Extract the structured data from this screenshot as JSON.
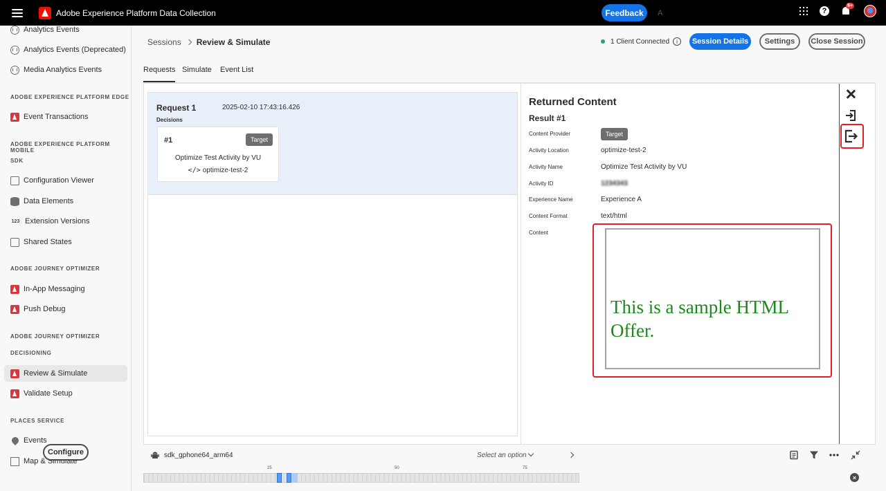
{
  "topbar": {
    "app_title": "Adobe Experience Platform Data Collection",
    "feedback_label": "Feedback",
    "org_picker": "A",
    "notification_count": "9+"
  },
  "sidebar": {
    "items": [
      {
        "label": "Analytics Events",
        "icon": "analytics-icon"
      },
      {
        "label": "Analytics Events (Deprecated)",
        "icon": "analytics-icon"
      },
      {
        "label": "Media Analytics Events",
        "icon": "analytics-icon"
      },
      {
        "label": "Event Transactions",
        "icon": "adobe-icon"
      },
      {
        "label": "Configuration Viewer",
        "icon": "viewer-icon"
      },
      {
        "label": "Data Elements",
        "icon": "database-icon"
      },
      {
        "label": "Extension Versions",
        "icon": "number-icon",
        "icon_text": "123"
      },
      {
        "label": "Shared States",
        "icon": "stack-icon"
      },
      {
        "label": "In-App Messaging",
        "icon": "adobe-icon"
      },
      {
        "label": "Push Debug",
        "icon": "adobe-icon"
      },
      {
        "label": "Review & Simulate",
        "icon": "adobe-icon",
        "active": true
      },
      {
        "label": "Validate Setup",
        "icon": "adobe-icon"
      },
      {
        "label": "Events",
        "icon": "pin-icon"
      },
      {
        "label": "Map & Simulate",
        "icon": "map-icon"
      }
    ],
    "sections": [
      "ADOBE EXPERIENCE PLATFORM EDGE",
      "ADOBE EXPERIENCE PLATFORM MOBILE",
      "SDK",
      "ADOBE JOURNEY OPTIMIZER",
      "ADOBE JOURNEY OPTIMIZER",
      "DECISIONING",
      "PLACES SERVICE"
    ],
    "configure_label": "Configure"
  },
  "header": {
    "breadcrumb_root": "Sessions",
    "breadcrumb_current": "Review & Simulate",
    "connection_status": "1 Client Connected",
    "session_details_label": "Session Details",
    "settings_label": "Settings",
    "close_session_label": "Close Session"
  },
  "tabs": [
    "Requests",
    "Simulate",
    "Event List"
  ],
  "request": {
    "title": "Request 1",
    "timestamp": "2025-02-10 17:43:16.426",
    "decisions_label": "Decisions",
    "decision": {
      "number": "#1",
      "tag": "Target",
      "activity_name": "Optimize Test Activity by VU",
      "location": "optimize-test-2"
    }
  },
  "returned": {
    "title": "Returned Content",
    "result_title": "Result #1",
    "fields": {
      "content_provider_label": "Content Provider",
      "content_provider_value": "Target",
      "activity_location_label": "Activity Location",
      "activity_location_value": "optimize-test-2",
      "activity_name_label": "Activity Name",
      "activity_name_value": "Optimize Test Activity by VU",
      "activity_id_label": "Activity ID",
      "activity_id_value": "1234343",
      "experience_name_label": "Experience Name",
      "experience_name_value": "Experience A",
      "content_format_label": "Content Format",
      "content_format_value": "text/html",
      "content_label": "Content"
    },
    "content_html_text": "This is a sample HTML Offer."
  },
  "bottom": {
    "device_name": "sdk_gphone64_arm64",
    "select_placeholder": "Select an option"
  },
  "timeline": {
    "tick_labels": [
      "25",
      "50",
      "75"
    ],
    "events_at": [
      26,
      28
    ]
  },
  "colors": {
    "accent": "#1473e6",
    "highlight": "#e01e24",
    "offer_text": "#1a8a1a",
    "request_card_bg": "#e8eff9"
  }
}
